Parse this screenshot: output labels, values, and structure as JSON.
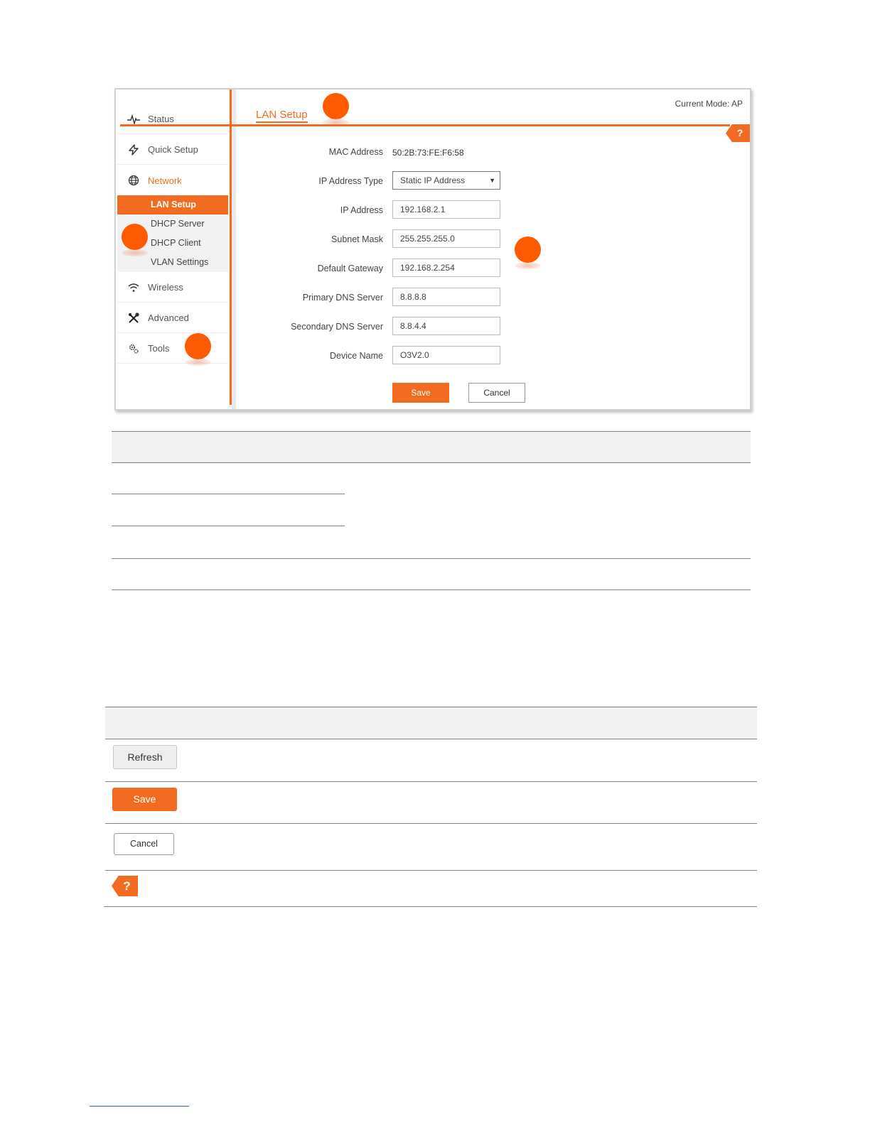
{
  "screenshot": {
    "title": "LAN Setup",
    "current_mode": "Current Mode: AP",
    "help_label": "?",
    "sidebar": {
      "items": [
        {
          "label": "Status",
          "icon": "pulse-icon"
        },
        {
          "label": "Quick Setup",
          "icon": "lightning-icon"
        },
        {
          "label": "Network",
          "icon": "globe-icon"
        },
        {
          "label": "Wireless",
          "icon": "wifi-icon"
        },
        {
          "label": "Advanced",
          "icon": "tools-cross-icon"
        },
        {
          "label": "Tools",
          "icon": "gears-icon"
        }
      ],
      "network_sub": [
        "LAN Setup",
        "DHCP Server",
        "DHCP Client",
        "VLAN Settings"
      ]
    },
    "form": {
      "mac_label": "MAC Address",
      "mac_value": "50:2B:73:FE:F6:58",
      "ip_type_label": "IP Address Type",
      "ip_type_value": "Static IP Address",
      "ip_label": "IP Address",
      "ip_value": "192.168.2.1",
      "mask_label": "Subnet Mask",
      "mask_value": "255.255.255.0",
      "gateway_label": "Default Gateway",
      "gateway_value": "192.168.2.254",
      "dns1_label": "Primary DNS Server",
      "dns1_value": "8.8.8.8",
      "dns2_label": "Secondary DNS Server",
      "dns2_value": "8.8.4.4",
      "device_label": "Device Name",
      "device_value": "O3V2.0"
    },
    "save_label": "Save",
    "cancel_label": "Cancel"
  },
  "button_table": {
    "refresh_label": "Refresh",
    "save_label": "Save",
    "cancel_label": "Cancel",
    "help_label": "?"
  },
  "colors": {
    "accent": "#f26b21",
    "marker": "#ff5a00"
  }
}
